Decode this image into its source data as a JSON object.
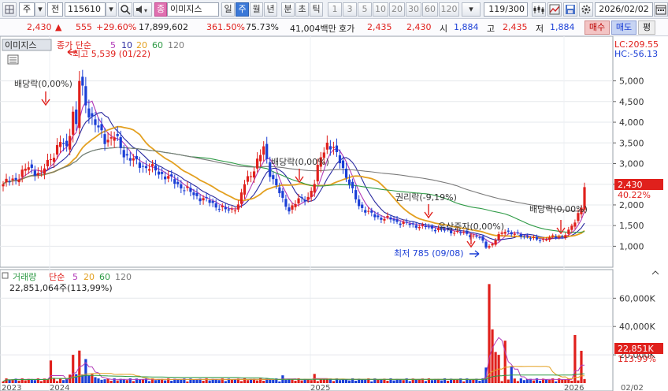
{
  "toolbar": {
    "type_label": "주",
    "jeon_label": "전",
    "code": "115610",
    "tag_label": "종",
    "stock_name": "이미지스",
    "periods": [
      "일",
      "주",
      "월",
      "년",
      "분",
      "초",
      "틱"
    ],
    "numbers": [
      "1",
      "3",
      "5",
      "10",
      "20",
      "30",
      "60",
      "120"
    ],
    "page_count": "119/300",
    "date": "2026/02/02"
  },
  "quote": {
    "price": "2,430",
    "change": "555",
    "change_pct": "+29.60%",
    "volume": "17,899,602",
    "turnover_pct": "361.50%",
    "rate2": "75.73%",
    "amount": "41,004백만",
    "hoga_label": "호가",
    "ask": "2,435",
    "bid": "2,430",
    "open_label": "시",
    "open": "1,884",
    "high_label": "고",
    "high": "2,435",
    "low_label": "저",
    "low": "1,884",
    "buy_label": "매수",
    "sell_label": "매도",
    "eval_label": "평"
  },
  "price_panel": {
    "name": "이미지스",
    "legend_title": "종가 단순",
    "ma": [
      "5",
      "10",
      "20",
      "60",
      "120"
    ],
    "lc": "LC:209.55",
    "hc": "HC:-56.13",
    "max_label": "최고 5,539 (01/22)",
    "min_label": "최저 785 (09/08)",
    "annotations": [
      "배당락(0,00%)",
      "배당락(0,00%)",
      "권리락(-9,19%)",
      "유상증자(0,00%)",
      "배당락(0,00%)"
    ],
    "cur_price": "2,430",
    "cur_pct": "40.22%"
  },
  "volume_panel": {
    "name": "거래량",
    "legend_title": "단순",
    "ma": [
      "5",
      "20",
      "60",
      "120"
    ],
    "cur_label": "22,851,064주(113,99%)",
    "cur_vol": "22,851K",
    "cur_pct": "113.99%"
  },
  "x_labels": [
    "2023",
    "2024",
    "2025",
    "2026",
    "02/02"
  ],
  "colors": {
    "up": "#e0201c",
    "down": "#1b3fd6",
    "ma5": "#b23ab8",
    "ma10": "#2a2aa0",
    "ma20": "#e3a020",
    "ma60": "#2e9a45",
    "ma120": "#7a7a7a"
  },
  "chart_data": {
    "type": "candlestick",
    "title": "이미지스",
    "price_axis": {
      "ticks": [
        1000,
        1500,
        2000,
        2500,
        3000,
        3500,
        4000,
        4500,
        5000
      ],
      "ylim": [
        550,
        5850
      ]
    },
    "volume_axis": {
      "ticks": [
        20000,
        40000,
        60000
      ],
      "tick_labels": [
        "20,000K",
        "40,000K",
        "60,000K"
      ],
      "ylim": [
        0,
        78000
      ]
    },
    "weekly_close_path": [
      [
        0,
        2500
      ],
      [
        4,
        2650
      ],
      [
        8,
        2900
      ],
      [
        12,
        2750
      ],
      [
        15,
        3150
      ],
      [
        18,
        3500
      ],
      [
        20,
        3350
      ],
      [
        22,
        4300
      ],
      [
        23,
        3900
      ],
      [
        24,
        5000
      ],
      [
        26,
        4450
      ],
      [
        28,
        4100
      ],
      [
        30,
        3800
      ],
      [
        32,
        3600
      ],
      [
        35,
        3650
      ],
      [
        38,
        3250
      ],
      [
        42,
        3000
      ],
      [
        46,
        2900
      ],
      [
        50,
        2750
      ],
      [
        55,
        2500
      ],
      [
        60,
        2250
      ],
      [
        64,
        2100
      ],
      [
        68,
        1950
      ],
      [
        71,
        1850
      ],
      [
        74,
        2000
      ],
      [
        76,
        2500
      ],
      [
        79,
        2900
      ],
      [
        82,
        3350
      ],
      [
        84,
        2800
      ],
      [
        86,
        2450
      ],
      [
        88,
        2100
      ],
      [
        90,
        1900
      ],
      [
        93,
        2100
      ],
      [
        96,
        2200
      ],
      [
        98,
        2500
      ],
      [
        100,
        3200
      ],
      [
        102,
        3500
      ],
      [
        104,
        3300
      ],
      [
        106,
        3100
      ],
      [
        108,
        2700
      ],
      [
        110,
        2300
      ],
      [
        112,
        2000
      ],
      [
        115,
        1800
      ],
      [
        118,
        1700
      ],
      [
        122,
        1650
      ],
      [
        126,
        1550
      ],
      [
        130,
        1500
      ],
      [
        134,
        1450
      ],
      [
        138,
        1400
      ],
      [
        142,
        1350
      ],
      [
        146,
        1300
      ],
      [
        150,
        1200
      ],
      [
        152,
        1000
      ],
      [
        154,
        1050
      ],
      [
        156,
        1250
      ],
      [
        158,
        1400
      ],
      [
        160,
        1300
      ],
      [
        164,
        1250
      ],
      [
        168,
        1150
      ],
      [
        172,
        1200
      ],
      [
        176,
        1250
      ],
      [
        178,
        1350
      ],
      [
        180,
        1600
      ],
      [
        182,
        2000
      ],
      [
        183,
        2430
      ]
    ],
    "volume_spikes": [
      [
        15,
        16000
      ],
      [
        22,
        20000
      ],
      [
        24,
        23000
      ],
      [
        26,
        17000
      ],
      [
        88,
        5500
      ],
      [
        98,
        6500
      ],
      [
        152,
        11000
      ],
      [
        153,
        70000
      ],
      [
        154,
        38000
      ],
      [
        155,
        22000
      ],
      [
        156,
        20000
      ],
      [
        158,
        30000
      ],
      [
        160,
        12000
      ],
      [
        180,
        34000
      ],
      [
        182,
        22851
      ]
    ]
  }
}
